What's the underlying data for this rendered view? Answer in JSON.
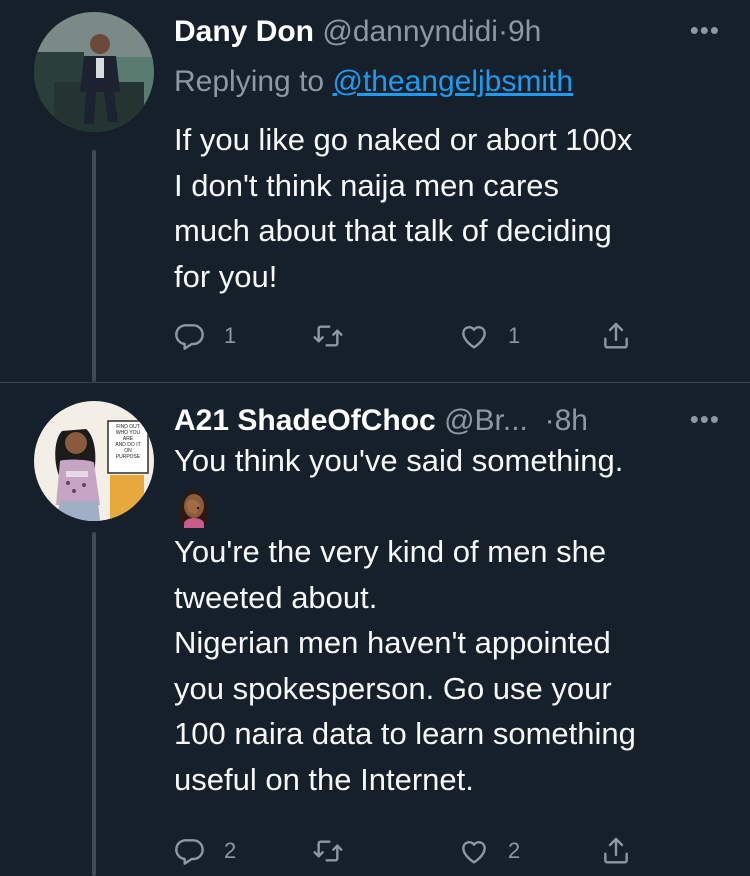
{
  "tweets": [
    {
      "display_name": "Dany Don",
      "handle": "@dannyndidi",
      "separator": "·",
      "time": "9h",
      "more": "•••",
      "replying_prefix": "Replying to",
      "replying_to": "@theangeljbsmith",
      "body_lines": [
        "If you like go naked or abort 100x",
        "I don't think naija men cares",
        "much about that talk of deciding",
        "for you!"
      ],
      "reply_count": "1",
      "retweet_count": "",
      "like_count": "1"
    },
    {
      "display_name": "A21 ShadeOfChoc",
      "handle": "@Br...",
      "separator": "·",
      "time": "8h",
      "more": "•••",
      "avatar_sign": [
        "FIND OUT",
        "WHO YOU",
        "ARE",
        "AND DO IT",
        "ON",
        "PURPOSE"
      ],
      "body_lines": [
        "You think you've said something.",
        "",
        "You're the very kind of men she",
        "tweeted about.",
        "Nigerian men haven't appointed",
        "you spokesperson. Go use your",
        "100 naira data to learn something",
        "useful on the Internet."
      ],
      "reply_count": "2",
      "retweet_count": "",
      "like_count": "2"
    }
  ],
  "icons": {
    "reply": "reply-icon",
    "retweet": "retweet-icon",
    "like": "heart-icon",
    "share": "share-icon",
    "emoji": "facepalm-emoji"
  },
  "colors": {
    "background": "#15202b",
    "text": "#f7f9f9",
    "secondary": "#8b98a5",
    "link": "#1d9bf0",
    "divider": "#38444d"
  }
}
